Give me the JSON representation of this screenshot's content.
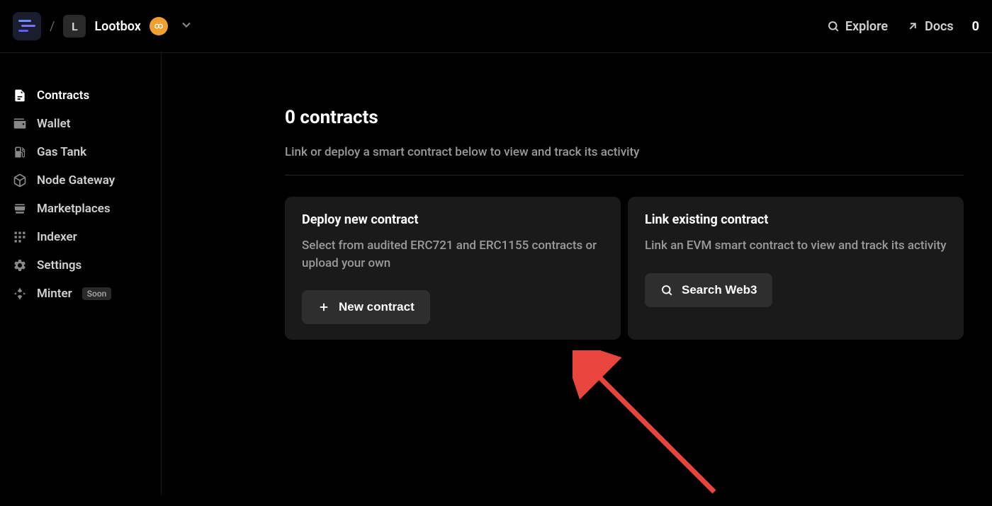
{
  "header": {
    "project_initial": "L",
    "project_name": "Lootbox",
    "explore_label": "Explore",
    "docs_label": "Docs",
    "credits": "0"
  },
  "sidebar": {
    "items": [
      {
        "label": "Contracts",
        "icon": "contracts",
        "active": true
      },
      {
        "label": "Wallet",
        "icon": "wallet"
      },
      {
        "label": "Gas Tank",
        "icon": "gastank"
      },
      {
        "label": "Node Gateway",
        "icon": "nodegateway"
      },
      {
        "label": "Marketplaces",
        "icon": "marketplace"
      },
      {
        "label": "Indexer",
        "icon": "indexer"
      },
      {
        "label": "Settings",
        "icon": "settings"
      },
      {
        "label": "Minter",
        "icon": "minter",
        "badge": "Soon"
      }
    ]
  },
  "main": {
    "title": "0 contracts",
    "subtitle": "Link or deploy a smart contract below to view and track its activity",
    "cards": [
      {
        "title": "Deploy new contract",
        "description": "Select from audited ERC721 and ERC1155 contracts or upload your own",
        "button_label": "New contract"
      },
      {
        "title": "Link existing contract",
        "description": "Link an EVM smart contract to view and track its activity",
        "button_label": "Search Web3"
      }
    ]
  }
}
